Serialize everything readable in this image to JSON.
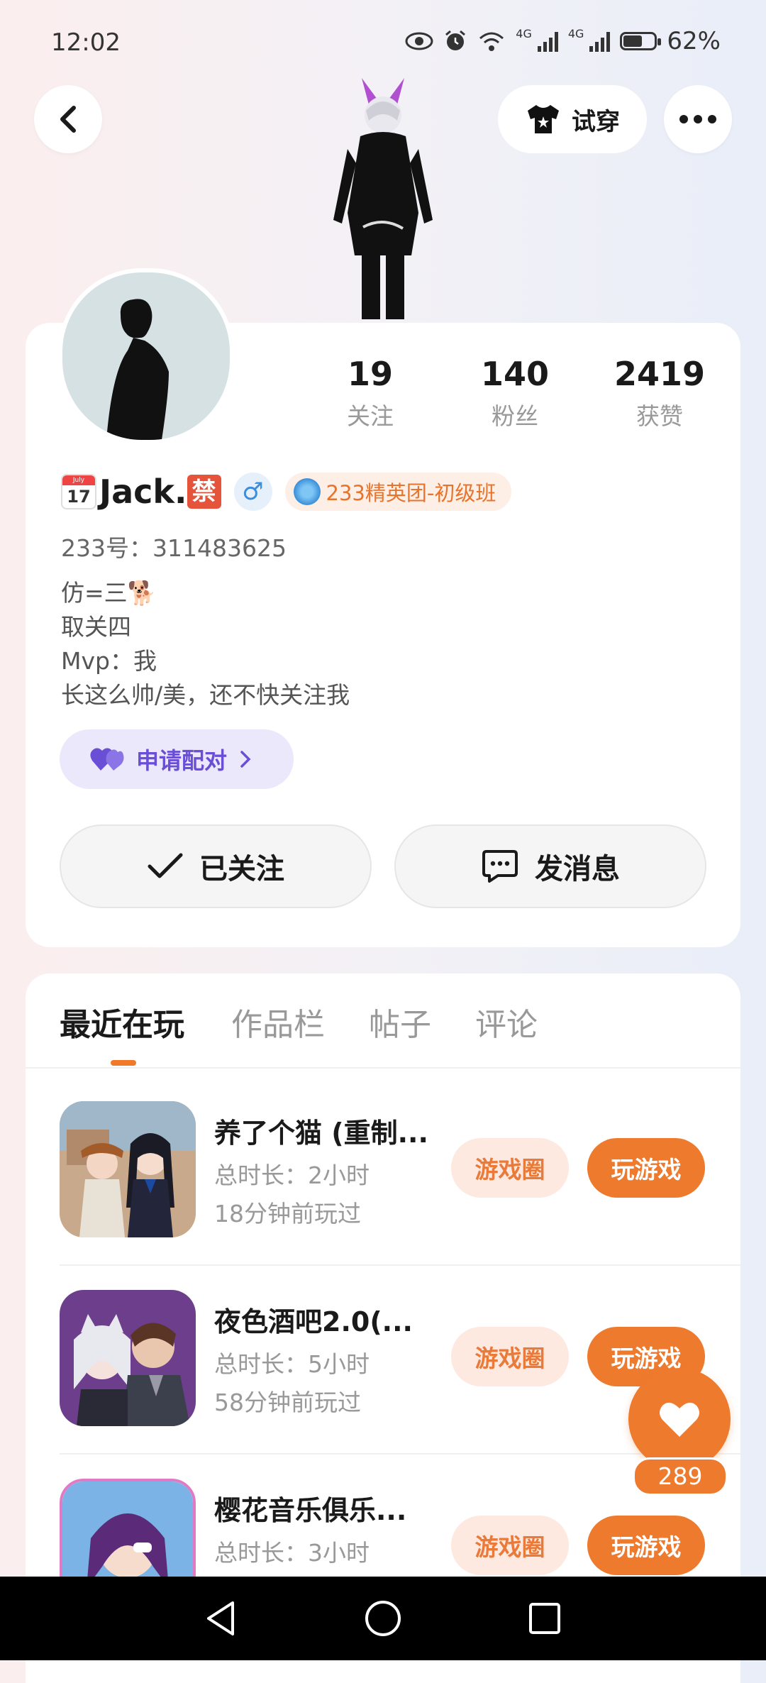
{
  "status_bar": {
    "time": "12:02",
    "net1": "4G",
    "net2": "4G",
    "battery": "62%",
    "battery_level": 0.62
  },
  "header": {
    "try_on_label": "试穿",
    "icons": [
      "back-icon",
      "shirt-icon",
      "more-icon"
    ]
  },
  "profile": {
    "stats": [
      {
        "num": "19",
        "label": "关注"
      },
      {
        "num": "140",
        "label": "粉丝"
      },
      {
        "num": "2419",
        "label": "获赞"
      }
    ],
    "calendar_month": "July",
    "calendar_day": "17",
    "name": "Jack.",
    "ban_char": "禁",
    "gender": "♂",
    "badge": "233精英团-初级班",
    "uid": "233号：311483625",
    "bio": [
      "仿=三🐕",
      "取关四",
      "Mvp：我",
      "长这么帅/美，还不快关注我"
    ],
    "pair_label": "申请配对",
    "follow_label": "已关注",
    "message_label": "发消息"
  },
  "tabs": [
    {
      "label": "最近在玩",
      "active": true
    },
    {
      "label": "作品栏",
      "active": false
    },
    {
      "label": "帖子",
      "active": false
    },
    {
      "label": "评论",
      "active": false
    }
  ],
  "games": [
    {
      "name": "养了个猫 (重制...",
      "duration": "总时长：2小时",
      "last": "18分钟前玩过",
      "circle": "游戏圈",
      "play": "玩游戏"
    },
    {
      "name": "夜色酒吧2.0(...",
      "duration": "总时长：5小时",
      "last": "58分钟前玩过",
      "circle": "游戏圈",
      "play": "玩游戏"
    },
    {
      "name": "樱花音乐俱乐...",
      "duration": "总时长：3小时",
      "last": "",
      "circle": "游戏圈",
      "play": "玩游戏"
    }
  ],
  "like_fab": {
    "count": "289"
  },
  "colors": {
    "accent": "#ee7a2e",
    "pair_purple": "#6a4fd6",
    "badge_orange": "#e8742c"
  }
}
